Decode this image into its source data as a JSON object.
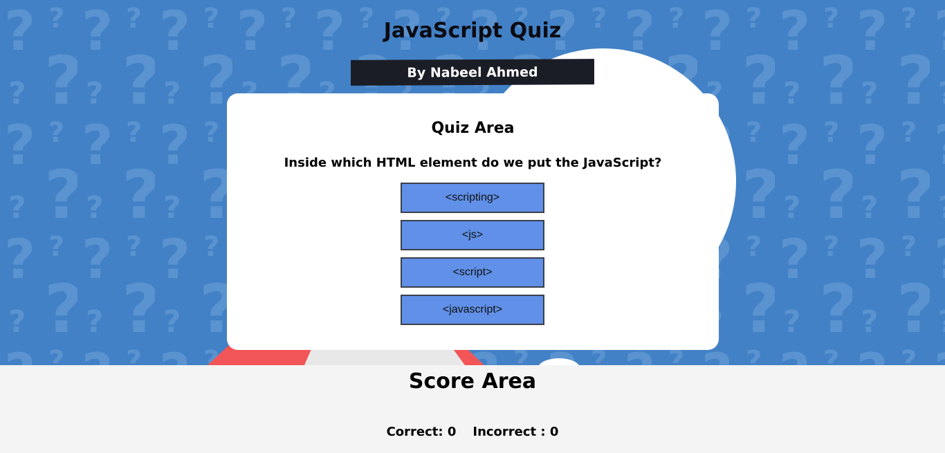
{
  "header": {
    "title": "JavaScript Quiz",
    "author": "By Nabeel Ahmed"
  },
  "quiz": {
    "title": "Quiz Area",
    "question": "Inside which HTML element do we put the JavaScript?",
    "options": [
      "<scripting>",
      "<js>",
      "<script>",
      "<javascript>"
    ]
  },
  "score": {
    "title": "Score Area",
    "correct_label": "Correct: 0",
    "incorrect_label": "Incorrect : 0"
  },
  "colors": {
    "hero_background": "#4381c6",
    "author_banner": "#1b1d26",
    "option_button": "#6090e8",
    "score_background": "#f4f4f4"
  },
  "icons": {
    "background_pattern": "question-mark-icon"
  }
}
